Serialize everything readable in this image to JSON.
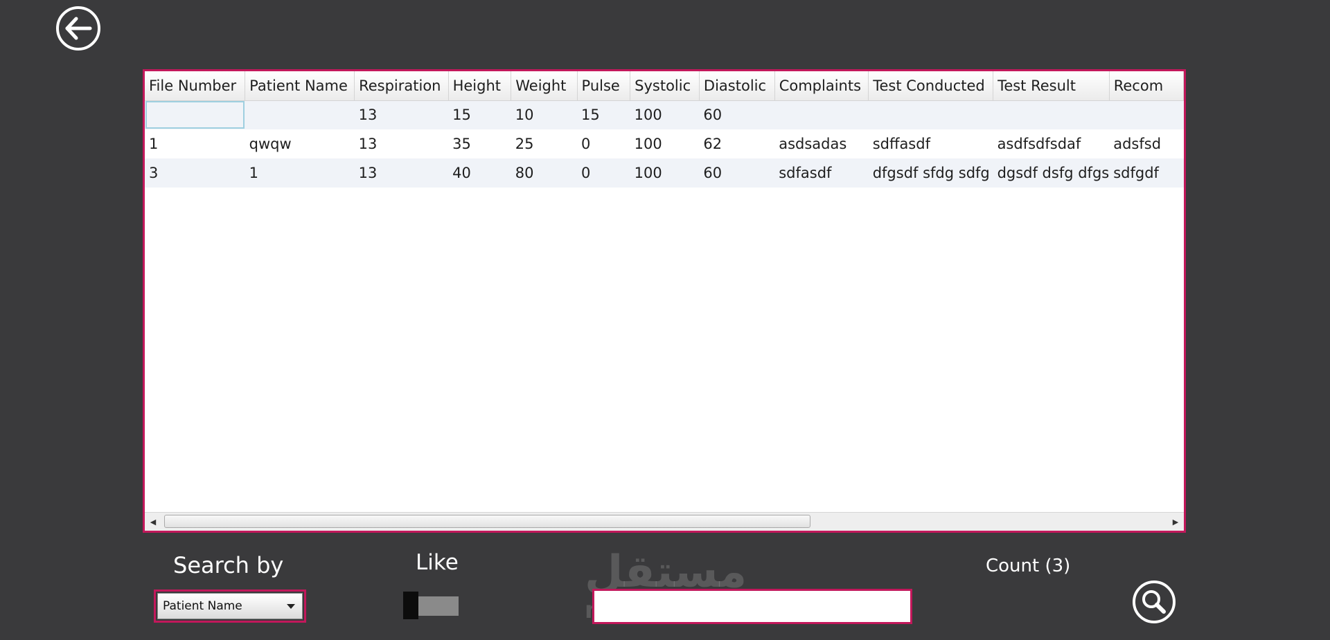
{
  "back_button": {
    "icon": "arrow-left-circle-icon"
  },
  "grid": {
    "columns": [
      "File Number",
      "Patient Name",
      "Respiration",
      "Height",
      "Weight",
      "Pulse",
      "Systolic",
      "Diastolic",
      "Complaints",
      "Test Conducted",
      "Test Result",
      "Recom"
    ],
    "rows": [
      [
        "",
        "",
        "13",
        "15",
        "10",
        "15",
        "100",
        "60",
        "",
        "",
        "",
        ""
      ],
      [
        "1",
        "qwqw",
        "13",
        "35",
        "25",
        "0",
        "100",
        "62",
        "asdsadas",
        "sdffasdf",
        "asdfsdfsdaf",
        "adsfsd"
      ],
      [
        "3",
        "1",
        "13",
        "40",
        "80",
        "0",
        "100",
        "60",
        "sdfasdf",
        "dfgsdf sfdg sdfg",
        "dgsdf dsfg dfgs",
        "sdfgdf"
      ]
    ],
    "selected_cell": {
      "row": 0,
      "col": 0
    }
  },
  "search": {
    "search_by_label": "Search by",
    "search_by_value": "Patient Name",
    "like_label": "Like",
    "count_label": "Count (3)",
    "input_value": "",
    "search_icon": "magnifier-circle-icon"
  },
  "watermark": {
    "arabic": "مستقل",
    "latin": "mostaql.com"
  },
  "colors": {
    "background": "#3a3a3c",
    "accent_border": "#c2185b"
  }
}
